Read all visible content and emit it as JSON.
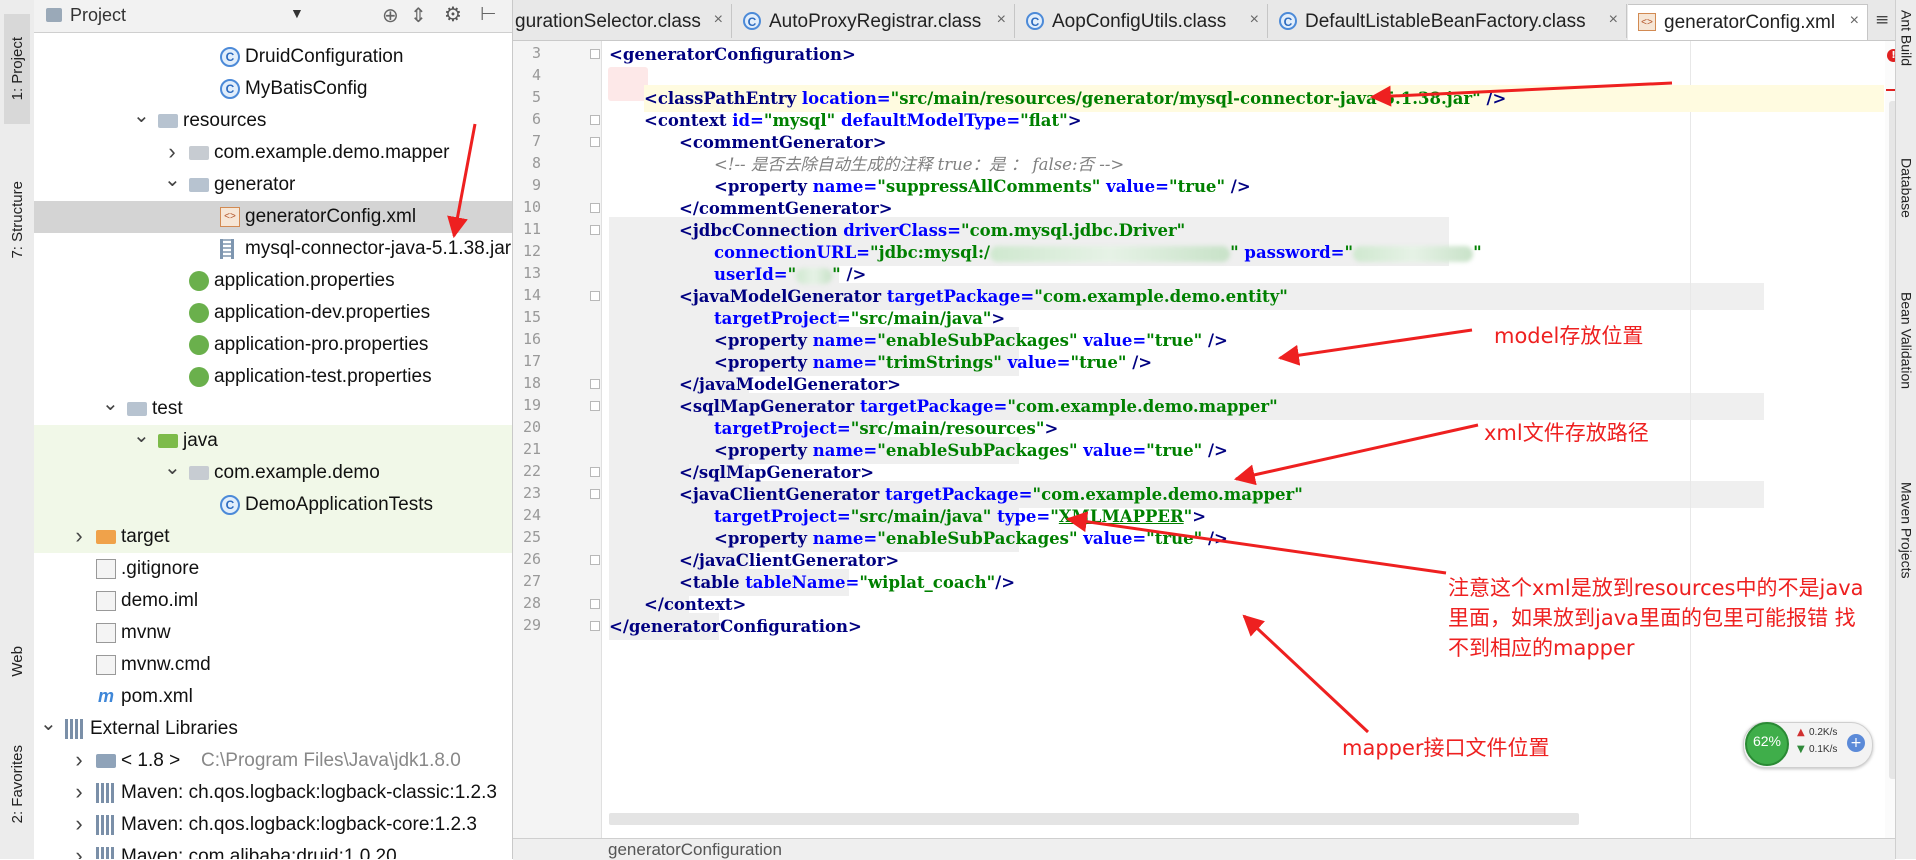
{
  "left_strip": {
    "tabs": [
      "1: Project",
      "7: Structure",
      "Web",
      "2: Favorites"
    ]
  },
  "project_panel": {
    "title": "Project",
    "tree": [
      {
        "label": "DruidConfiguration",
        "icon": "class-icon",
        "indent": 5,
        "arrow": ""
      },
      {
        "label": "MyBatisConfig",
        "icon": "class-icon",
        "indent": 5,
        "arrow": ""
      },
      {
        "label": "resources",
        "icon": "resources-folder-icon",
        "indent": 3,
        "arrow": "v"
      },
      {
        "label": "com.example.demo.mapper",
        "icon": "package-icon",
        "indent": 4,
        "arrow": ">"
      },
      {
        "label": "generator",
        "icon": "folder-icon",
        "indent": 4,
        "arrow": "v"
      },
      {
        "label": "generatorConfig.xml",
        "icon": "xml-file-icon",
        "indent": 5,
        "arrow": "",
        "selected": true
      },
      {
        "label": "mysql-connector-java-5.1.38.jar",
        "icon": "jar-file-icon",
        "indent": 5,
        "arrow": ""
      },
      {
        "label": "application.properties",
        "icon": "properties-file-icon",
        "indent": 4,
        "arrow": ""
      },
      {
        "label": "application-dev.properties",
        "icon": "properties-file-icon",
        "indent": 4,
        "arrow": ""
      },
      {
        "label": "application-pro.properties",
        "icon": "properties-file-icon",
        "indent": 4,
        "arrow": ""
      },
      {
        "label": "application-test.properties",
        "icon": "properties-file-icon",
        "indent": 4,
        "arrow": ""
      },
      {
        "label": "test",
        "icon": "folder-icon",
        "indent": 2,
        "arrow": "v"
      },
      {
        "label": "java",
        "icon": "test-source-folder-icon",
        "indent": 3,
        "arrow": "v",
        "test": true
      },
      {
        "label": "com.example.demo",
        "icon": "package-icon",
        "indent": 4,
        "arrow": "v",
        "test": true
      },
      {
        "label": "DemoApplicationTests",
        "icon": "class-icon",
        "indent": 5,
        "arrow": "",
        "test": true
      },
      {
        "label": "target",
        "icon": "excluded-folder-icon",
        "indent": 1,
        "arrow": ">",
        "test": true
      },
      {
        "label": ".gitignore",
        "icon": "file-icon",
        "indent": 1,
        "arrow": ""
      },
      {
        "label": "demo.iml",
        "icon": "file-icon",
        "indent": 1,
        "arrow": ""
      },
      {
        "label": "mvnw",
        "icon": "file-icon",
        "indent": 1,
        "arrow": ""
      },
      {
        "label": "mvnw.cmd",
        "icon": "file-icon",
        "indent": 1,
        "arrow": ""
      },
      {
        "label": "pom.xml",
        "icon": "maven-icon",
        "indent": 1,
        "arrow": ""
      },
      {
        "label": "External Libraries",
        "icon": "libraries-icon",
        "indent": 0,
        "arrow": "v"
      },
      {
        "label": "< 1.8 >",
        "extra": "C:\\Program Files\\Java\\jdk1.8.0",
        "icon": "jdk-icon",
        "indent": 1,
        "arrow": ">"
      },
      {
        "label": "Maven: ch.qos.logback:logback-classic:1.2.3",
        "icon": "library-icon",
        "indent": 1,
        "arrow": ">"
      },
      {
        "label": "Maven: ch.qos.logback:logback-core:1.2.3",
        "icon": "library-icon",
        "indent": 1,
        "arrow": ">"
      },
      {
        "label": "Maven: com.alibaba:druid:1.0.20",
        "icon": "library-icon",
        "indent": 1,
        "arrow": ">"
      }
    ]
  },
  "tabs": [
    {
      "label": "gurationSelector.class",
      "icon": "",
      "active": false
    },
    {
      "label": "AutoProxyRegistrar.class",
      "icon": "class-icon",
      "active": false
    },
    {
      "label": "AopConfigUtils.class",
      "icon": "class-icon",
      "active": false
    },
    {
      "label": "DefaultListableBeanFactory.class",
      "icon": "class-icon",
      "active": false
    },
    {
      "label": "generatorConfig.xml",
      "icon": "xml-file-icon",
      "active": true
    }
  ],
  "tab_overflow": "≡",
  "code": {
    "lines": [
      3,
      4,
      5,
      6,
      7,
      8,
      9,
      10,
      11,
      12,
      13,
      14,
      15,
      16,
      17,
      18,
      19,
      20,
      21,
      22,
      23,
      24,
      25,
      26,
      27,
      28,
      29
    ],
    "root_tag": "generatorConfiguration",
    "class_path_location": "src/main/resources/generator/mysql-connector-java-5.1.38.jar",
    "context_id": "mysql",
    "context_model_type": "flat",
    "comment_text": "<!-- 是否去除自动生成的注释 true：是 ： false:否 -->",
    "suppress_comments": "suppressAllComments",
    "true_value": "true",
    "driver_class": "com.mysql.jdbc.Driver",
    "connection_url_prefix": "jdbc:mysql:/",
    "connection_url_rest": "",
    "password_value": "",
    "user_id_value": "",
    "model_package": "com.example.demo.entity",
    "model_project": "src/main/java",
    "enable_sub_packages": "enableSubPackages",
    "trim_strings": "trimStrings",
    "sqlmap_package": "com.example.demo.mapper",
    "sqlmap_project": "src/main/resources",
    "client_package": "com.example.demo.mapper",
    "client_project": "src/main/java",
    "client_type": "XMLMAPPER",
    "table_name": "wiplat_coach"
  },
  "status_bar": {
    "breadcrumb": "generatorConfiguration"
  },
  "right_strip": {
    "tabs": [
      "Ant Build",
      "Database",
      "Bean Validation",
      "Maven Projects"
    ]
  },
  "annotations": {
    "model": "model存放位置",
    "xml": "xml文件存放路径",
    "note_line1": "注意这个xml是放到resources中的不是java",
    "note_line2": "里面，如果放到java里面的包里可能报错 找",
    "note_line3": "不到相应的mapper",
    "mapper": "mapper接口文件位置",
    "color": "#ee2020"
  },
  "net_widget": {
    "percent": "62%",
    "up": "0.2K/s",
    "down": "0.1K/s"
  }
}
